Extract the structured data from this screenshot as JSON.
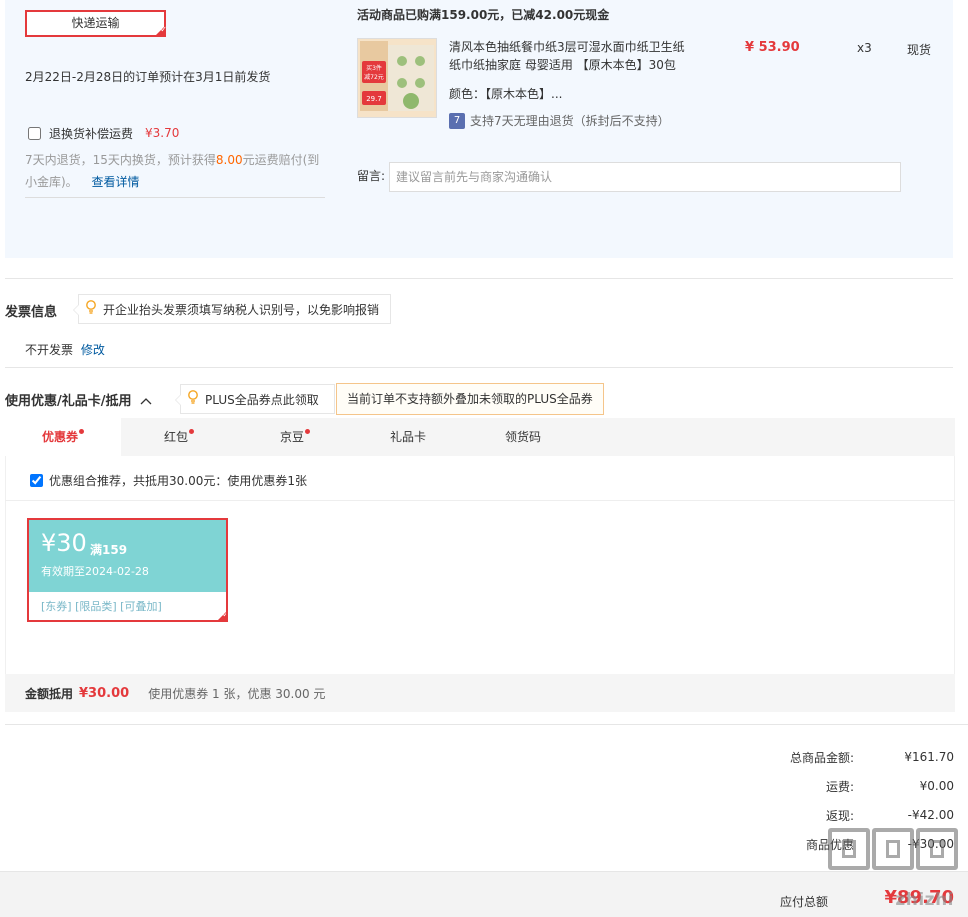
{
  "shipping": {
    "method_label": "快递运输",
    "date_note": "2月22日-2月28日的订单预计在3月1日前发货",
    "insurance_label": "退换货补偿运费",
    "insurance_price": "¥3.70",
    "return_desc_prefix": "7天内退货，15天内换货，预计获得",
    "return_desc_amount": "8.00",
    "return_desc_suffix": "元运费赔付(到小金库)。",
    "details_link": "查看详情"
  },
  "promotion": {
    "title": "活动商品已购满159.00元，已减42.00元现金"
  },
  "product": {
    "name": "清风本色抽纸餐巾纸3层可湿水面巾纸卫生纸纸巾纸抽家庭 母婴适用 【原木本色】30包",
    "price": "¥ 53.90",
    "qty": "x3",
    "stock": "现货",
    "color": "颜色：【原木本色】...",
    "return_badge": "7",
    "return_policy": "支持7天无理由退货（拆封后不支持）",
    "thumb_text": {
      "line1": "买3件",
      "line2": "减72元",
      "price": "29.7"
    }
  },
  "message": {
    "label": "留言:",
    "placeholder": "建议留言前先与商家沟通确认"
  },
  "invoice": {
    "title": "发票信息",
    "tip": "开企业抬头发票须填写纳税人识别号，以免影响报销",
    "status": "不开发票",
    "edit_link": "修改"
  },
  "discount": {
    "title": "使用优惠/礼品卡/抵用",
    "plus_tip": "PLUS全品券点此领取",
    "plus_note": "当前订单不支持额外叠加未领取的PLUS全品券",
    "tabs": [
      {
        "label": "优惠券",
        "dot": true
      },
      {
        "label": "红包",
        "dot": true
      },
      {
        "label": "京豆",
        "dot": true
      },
      {
        "label": "礼品卡",
        "dot": false
      },
      {
        "label": "领货码",
        "dot": false
      }
    ],
    "recommend_text": "优惠组合推荐，共抵用30.00元：使用优惠券1张",
    "coupon": {
      "amount": "¥30",
      "condition": "满159",
      "valid": "有效期至2024-02-28",
      "tags": "[东券] [限品类] [可叠加]"
    },
    "summary_label": "金额抵用",
    "summary_amount": "¥30.00",
    "summary_desc": "使用优惠券 1 张，优惠 30.00 元"
  },
  "totals": {
    "rows": [
      {
        "label": "总商品金额:",
        "value": "¥161.70"
      },
      {
        "label": "运费:",
        "value": "¥0.00"
      },
      {
        "label": "返现:",
        "value": "-¥42.00"
      },
      {
        "label": "商品优惠",
        "value": "-¥30.00"
      }
    ],
    "payable_label": "应付总额",
    "payable_amount": "¥89.70"
  },
  "watermark": {
    "text": "zhizhi"
  },
  "colors": {
    "accent": "#e4393c",
    "panel_bg": "#f3f8fe",
    "coupon_bg": "#7fd4d4",
    "link": "#005aa0"
  }
}
